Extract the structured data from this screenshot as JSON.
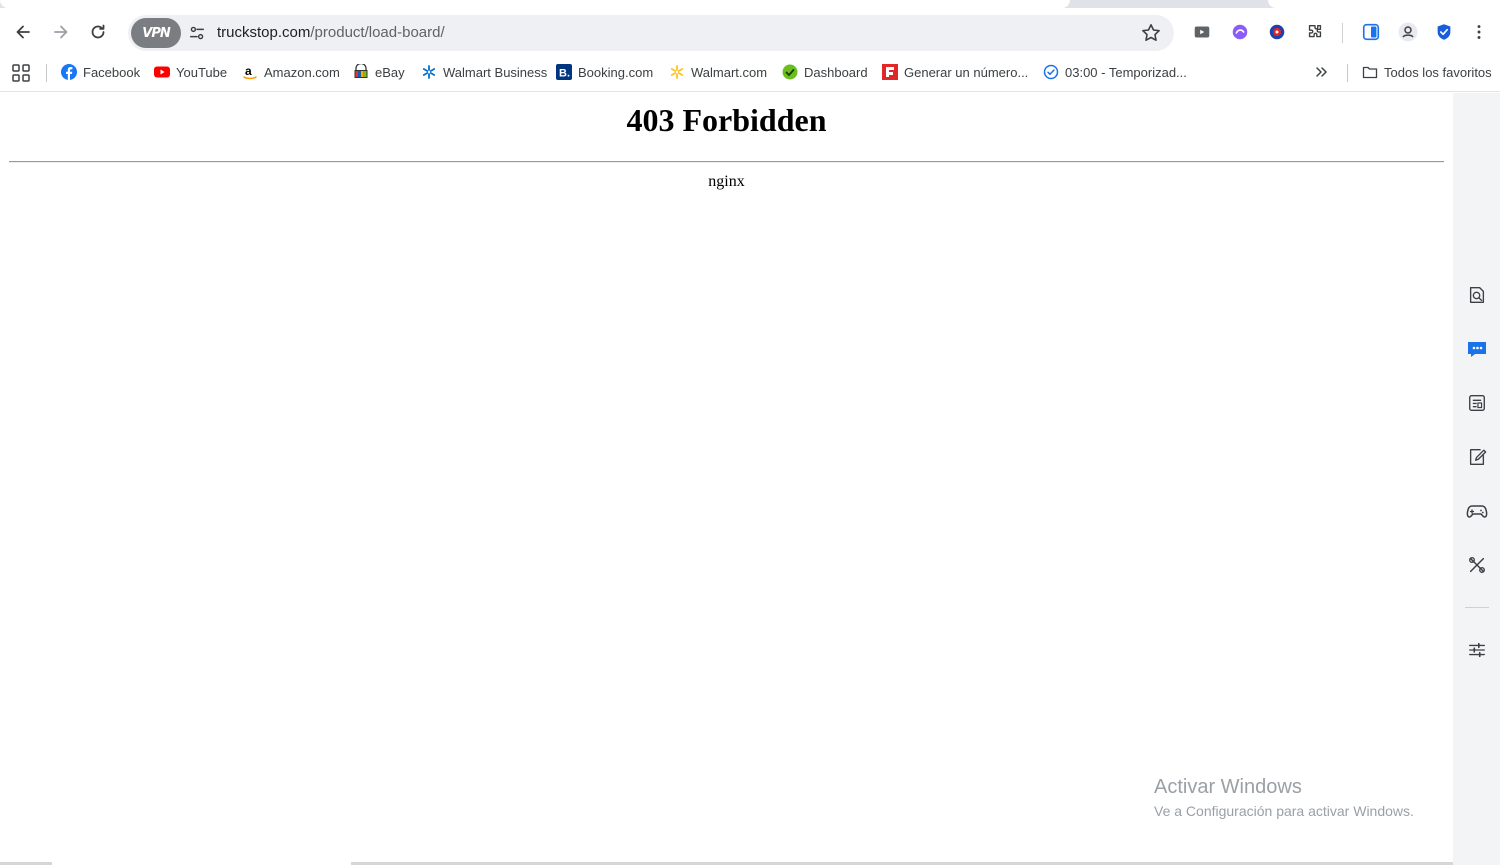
{
  "browser": {
    "url_host": "truckstop.com",
    "url_path": "/product/load-board/",
    "vpn_label": "VPN"
  },
  "bookmarks": [
    {
      "label": "Facebook",
      "icon": "facebook-icon",
      "color": "#1877f2"
    },
    {
      "label": "YouTube",
      "icon": "youtube-icon",
      "color": "#ff0000"
    },
    {
      "label": "Amazon.com",
      "icon": "amazon-icon",
      "color": "#000000"
    },
    {
      "label": "eBay",
      "icon": "ebay-icon",
      "color": "#e53238"
    },
    {
      "label": "Walmart Business",
      "icon": "walmart-business-icon",
      "color": "#0071ce"
    },
    {
      "label": "Booking.com",
      "icon": "booking-icon",
      "color": "#003580"
    },
    {
      "label": "Walmart.com",
      "icon": "walmart-icon",
      "color": "#ffc220"
    },
    {
      "label": "Dashboard",
      "icon": "dashboard-icon",
      "color": "#6abf1e"
    },
    {
      "label": "Generar un número...",
      "icon": "flipboard-icon",
      "color": "#e12828"
    },
    {
      "label": "03:00 - Temporizad...",
      "icon": "timer-icon",
      "color": "#1a73e8"
    }
  ],
  "all_bookmarks_label": "Todos los favoritos",
  "page": {
    "heading": "403 Forbidden",
    "server": "nginx"
  },
  "watermark": {
    "title": "Activar Windows",
    "subtitle": "Ve a Configuración para activar Windows."
  },
  "side_panel": [
    "search-page-icon",
    "chat-icon",
    "reading-list-icon",
    "notes-icon",
    "games-icon",
    "tools-icon",
    "customize-icon"
  ]
}
